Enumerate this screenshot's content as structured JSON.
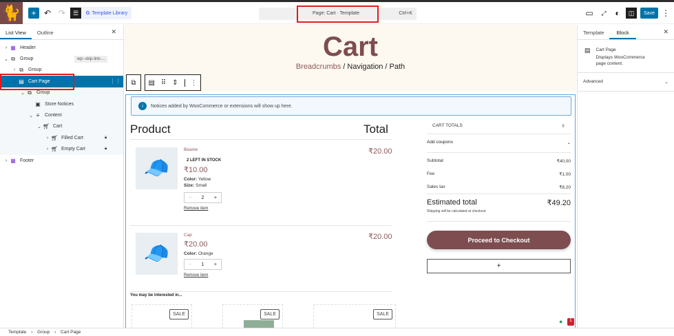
{
  "topbar": {
    "library_label": "Template Library",
    "command_label": "Page: Cart · Template",
    "shortcut": "Ctrl+K",
    "save_label": "Save"
  },
  "left": {
    "tabs": [
      "List View",
      "Outline"
    ],
    "items": [
      {
        "label": "Header"
      },
      {
        "label": "Group",
        "badge": "wp--skip-link-..."
      },
      {
        "label": "Group"
      },
      {
        "label": "Cart Page"
      },
      {
        "label": "Group"
      },
      {
        "label": "Store Notices"
      },
      {
        "label": "Content"
      },
      {
        "label": "Cart"
      },
      {
        "label": "Filled Cart"
      },
      {
        "label": "Empty Cart"
      },
      {
        "label": "Footer"
      }
    ]
  },
  "canvas": {
    "title": "Cart",
    "breadcrumb_link": "Breadcrumbs",
    "breadcrumb_rest": " / Navigation / Path",
    "notice": "Notices added by WooCommerce or extensions will show up here.",
    "product_header": "Product",
    "total_header": "Total",
    "items": [
      {
        "name": "Beanie",
        "stock": "2 LEFT IN STOCK",
        "price": "₹10.00",
        "attrs": [
          {
            "k": "Color:",
            "v": " Yellow"
          },
          {
            "k": "Size:",
            "v": " Small"
          }
        ],
        "qty": "2",
        "total": "₹20.00",
        "remove": "Remove item"
      },
      {
        "name": "Cap",
        "price": "₹20.00",
        "attrs": [
          {
            "k": "Color:",
            "v": " Orange"
          }
        ],
        "qty": "1",
        "total": "₹20.00",
        "remove": "Remove item"
      }
    ],
    "interested": "You may be interested in...",
    "sale": "SALE",
    "totals": {
      "heading": "CART TOTALS",
      "coupons": "Add coupons",
      "rows": [
        {
          "label": "Subtotal",
          "value": "₹40.00"
        },
        {
          "label": "Fee",
          "value": "₹1.00"
        },
        {
          "label": "Sales tax",
          "value": "₹8.20"
        }
      ],
      "estimated_label": "Estimated total",
      "estimated_value": "₹49.20",
      "shipping_note": "Shipping will be calculated at checkout",
      "checkout": "Proceed to Checkout",
      "add": "+"
    }
  },
  "right": {
    "tabs": [
      "Template",
      "Block"
    ],
    "block_name": "Cart Page",
    "block_desc": "Displays WooCommerce page content.",
    "advanced": "Advanced"
  },
  "status": {
    "crumbs": [
      "Template",
      "Group",
      "Cart Page"
    ],
    "sep": "›",
    "notif_count": "1"
  }
}
